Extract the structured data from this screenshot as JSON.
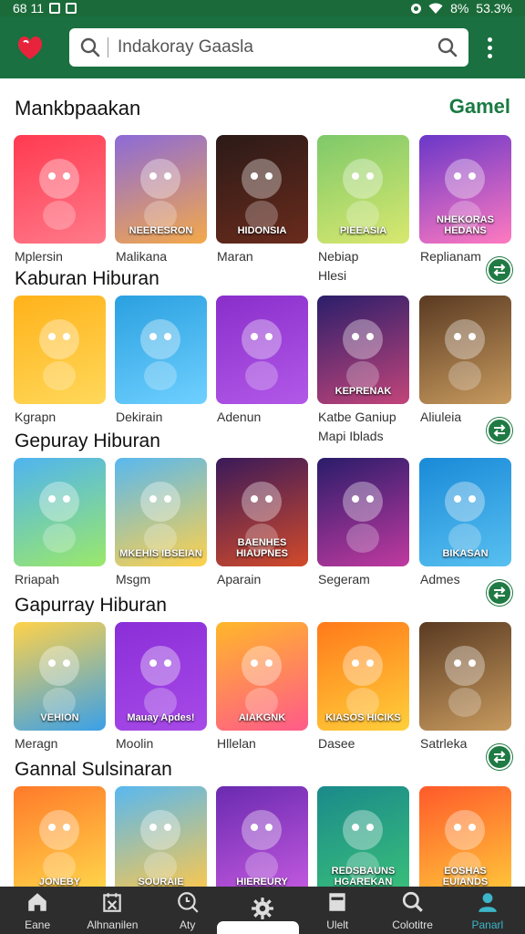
{
  "status_bar": {
    "time": "68 11",
    "battery": "8%",
    "extra": "53.3%"
  },
  "search": {
    "text": "Indakoray Gaasla"
  },
  "header": {
    "title": "Mankbpaakan",
    "link": "Gamel"
  },
  "sections": [
    {
      "title": "",
      "tiles": [
        {
          "label": "Mplersin",
          "label2": "",
          "caption": "",
          "color1": "#ff3a50",
          "color2": "#ff7a8a",
          "fab": false
        },
        {
          "label": "Malikana",
          "label2": "",
          "caption": "NEERESRON",
          "color1": "#8c6ad8",
          "color2": "#f4a94a",
          "fab": false
        },
        {
          "label": "Maran",
          "label2": "",
          "caption": "HIDONSIA",
          "color1": "#2b1a18",
          "color2": "#6a2b1c",
          "fab": false
        },
        {
          "label": "Nebiap",
          "label2": "Hlesi",
          "caption": "PIEEASIA",
          "color1": "#7ec96a",
          "color2": "#d9e86f",
          "fab": false
        },
        {
          "label": "Replianam",
          "label2": "",
          "caption": "NHEKORAS HEDANS",
          "color1": "#6a37c8",
          "color2": "#ff7ac0",
          "fab": true
        }
      ]
    },
    {
      "title": "Kaburan Hiburan",
      "tiles": [
        {
          "label": "Kgrapn",
          "label2": "",
          "caption": "",
          "color1": "#ffb21a",
          "color2": "#ffd85a",
          "fab": false
        },
        {
          "label": "Dekirain",
          "label2": "",
          "caption": "",
          "color1": "#2aa0e0",
          "color2": "#6fd0ff",
          "fab": false
        },
        {
          "label": "Adenun",
          "label2": "",
          "caption": "",
          "color1": "#8a2ecb",
          "color2": "#b259e8",
          "fab": false
        },
        {
          "label": "Katbe Ganiup",
          "label2": "Mapi Iblads",
          "caption": "KEPRENAK",
          "color1": "#2b1e6a",
          "color2": "#c2457a",
          "fab": false
        },
        {
          "label": "Aliuleia",
          "label2": "",
          "caption": "",
          "color1": "#5a3a22",
          "color2": "#c79a5e",
          "fab": true
        }
      ]
    },
    {
      "title": "Gepuray Hiburan",
      "tiles": [
        {
          "label": "Rriapah",
          "label2": "",
          "caption": "",
          "color1": "#4fb4f0",
          "color2": "#9be86a",
          "fab": false
        },
        {
          "label": "Msgm",
          "label2": "",
          "caption": "MKEHIS IBSEIAN",
          "color1": "#58b8f0",
          "color2": "#ffd14a",
          "fab": false
        },
        {
          "label": "Aparain",
          "label2": "",
          "caption": "BAENHES HIAUPNES",
          "color1": "#3a1a5a",
          "color2": "#d24a2a",
          "fab": false
        },
        {
          "label": "Segeram",
          "label2": "",
          "caption": "",
          "color1": "#2a1c6a",
          "color2": "#c03aa0",
          "fab": false
        },
        {
          "label": "Admes",
          "label2": "",
          "caption": "BIKASAN",
          "color1": "#1a8ad8",
          "color2": "#58c0f0",
          "fab": true
        }
      ]
    },
    {
      "title": "Gapurray Hiburan",
      "tiles": [
        {
          "label": "Meragn",
          "label2": "",
          "caption": "VEHION",
          "color1": "#ffd24a",
          "color2": "#3aa0e8",
          "fab": false
        },
        {
          "label": "Moolin",
          "label2": "",
          "caption": "Mauay Apdes!",
          "color1": "#8a2ed8",
          "color2": "#a84ae8",
          "fab": false
        },
        {
          "label": "Hllelan",
          "label2": "",
          "caption": "AIAKGNK",
          "color1": "#ffb72a",
          "color2": "#ff5a8a",
          "fab": false
        },
        {
          "label": "Dasee",
          "label2": "",
          "caption": "KIASOS HICIKS",
          "color1": "#ff7a1a",
          "color2": "#ffcf3a",
          "fab": false
        },
        {
          "label": "Satrleka",
          "label2": "",
          "caption": "",
          "color1": "#5a3a22",
          "color2": "#c79a5e",
          "fab": true
        }
      ]
    },
    {
      "title": "Gannal Sulsinaran",
      "tiles": [
        {
          "label": "",
          "label2": "",
          "caption": "JONEBY",
          "color1": "#ff7a2a",
          "color2": "#ffd84a",
          "fab": false
        },
        {
          "label": "",
          "label2": "",
          "caption": "SOURAIE",
          "color1": "#58b8f0",
          "color2": "#ffc84a",
          "fab": false
        },
        {
          "label": "",
          "label2": "",
          "caption": "HIEREURY",
          "color1": "#6a2ab0",
          "color2": "#c45ae0",
          "fab": false
        },
        {
          "label": "",
          "label2": "",
          "caption": "REDSBAUNS HGAREKAN",
          "color1": "#1a8a8a",
          "color2": "#3ac07a",
          "fab": false
        },
        {
          "label": "",
          "label2": "",
          "caption": "EOSHAS EUIANDS",
          "color1": "#ff5a2a",
          "color2": "#ffc83a",
          "fab": false
        }
      ]
    }
  ],
  "bottom_nav": [
    {
      "label": "Eane",
      "icon": "home-icon",
      "active": false
    },
    {
      "label": "Alhnanilen",
      "icon": "calendar-x-icon",
      "active": false
    },
    {
      "label": "Aty",
      "icon": "zoom-icon",
      "active": false
    },
    {
      "label": "",
      "icon": "gear-icon",
      "active": false
    },
    {
      "label": "Ulelt",
      "icon": "card-icon",
      "active": false
    },
    {
      "label": "Colotitre",
      "icon": "search-icon",
      "active": false
    },
    {
      "label": "Panarl",
      "icon": "profile-icon",
      "active": true
    }
  ],
  "colors": {
    "primary": "#1a7040",
    "accent": "#1a7a43",
    "nav_bg": "#2d2d2d",
    "nav_active": "#3cb6c8"
  }
}
